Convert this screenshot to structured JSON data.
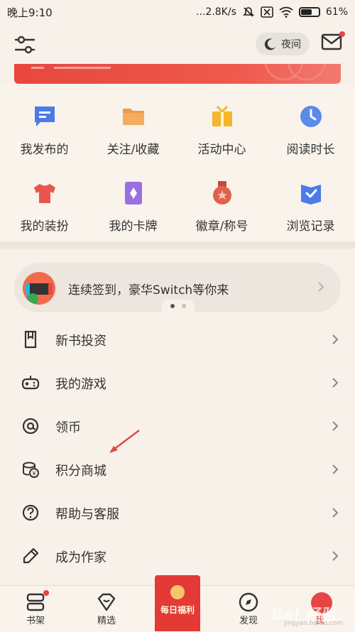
{
  "status_bar": {
    "time": "晚上9:10",
    "network_speed": "...2.8K/s",
    "battery": "61%",
    "battery_level": 0.61
  },
  "header": {
    "night_mode_label": "夜间"
  },
  "quick_grid": [
    {
      "label": "我发布的",
      "icon": "message-icon",
      "color": "#4a7be8"
    },
    {
      "label": "关注/收藏",
      "icon": "folder-icon",
      "color": "#f19a45"
    },
    {
      "label": "活动中心",
      "icon": "gift-icon",
      "color": "#f3b62c"
    },
    {
      "label": "阅读时长",
      "icon": "clock-icon",
      "color": "#5c8aeb"
    },
    {
      "label": "我的装扮",
      "icon": "tshirt-icon",
      "color": "#e9554b"
    },
    {
      "label": "我的卡牌",
      "icon": "card-icon",
      "color": "#9a6fe0"
    },
    {
      "label": "徽章/称号",
      "icon": "medal-icon",
      "color": "#e0614d"
    },
    {
      "label": "浏览记录",
      "icon": "book-icon",
      "color": "#4a7be8"
    }
  ],
  "signin_banner": {
    "text": "连续签到，豪华Switch等你来"
  },
  "menu": [
    {
      "label": "新书投资",
      "icon": "bookmark-icon"
    },
    {
      "label": "我的游戏",
      "icon": "gamepad-icon"
    },
    {
      "label": "领币",
      "icon": "at-icon"
    },
    {
      "label": "积分商城",
      "icon": "coins-icon"
    },
    {
      "label": "帮助与客服",
      "icon": "help-icon"
    },
    {
      "label": "成为作家",
      "icon": "pen-icon"
    }
  ],
  "tabs": {
    "bookshelf": "书架",
    "featured": "精选",
    "welfare": "每日福利",
    "discover": "发现",
    "me": "我"
  },
  "watermark": {
    "main": "Bai 经验",
    "sub": "jingyan.baidu.com"
  },
  "colors": {
    "accent_red": "#e54545",
    "background": "#f7f1ea"
  }
}
